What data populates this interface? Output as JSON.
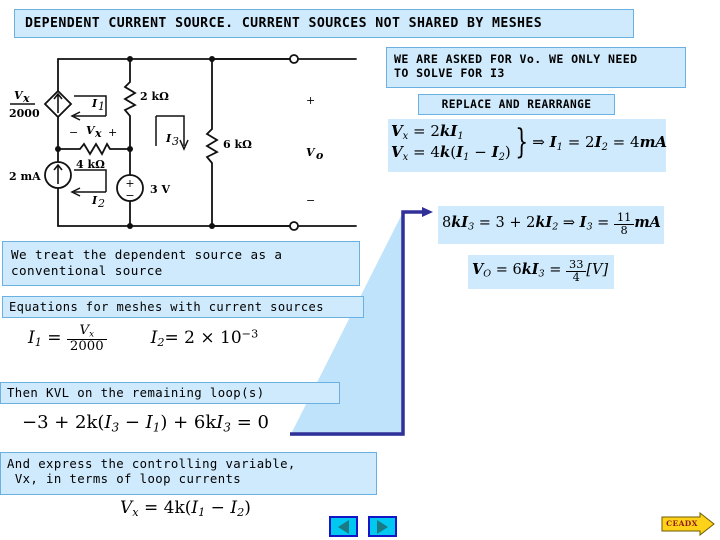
{
  "slide": {
    "title": "DEPENDENT CURRENT SOURCE. CURRENT SOURCES NOT SHARED BY MESHES",
    "background_color": "#ffffff",
    "callout_fill": "#cfeafc",
    "callout_border": "#6ab0e0",
    "arrow_fill": "#bfe3fa",
    "arrow_border": "#303098"
  },
  "callouts": {
    "asked": "WE ARE ASKED FOR Vo. WE ONLY NEED\nTO SOLVE FOR I3",
    "replace": "REPLACE AND REARRANGE",
    "treat": "We treat the dependent source as a\nconventional source",
    "meshes": "Equations for meshes with current sources",
    "kvl": "Then KVL on the remaining loop(s)",
    "express": "And express the controlling variable,\n Vx, in terms of loop currents"
  },
  "equations": {
    "i1_def": {
      "lhs": "I",
      "lhs_sub": "1",
      "eq": "=",
      "numerator": "V",
      "numerator_sub": "x",
      "denominator": "2000"
    },
    "i2_def": {
      "lhs": "I",
      "lhs_sub": "2",
      "eq": "=",
      "rhs": "2 × 10",
      "exponent": "−3"
    },
    "kvl_loop": {
      "text": "−3 + 2k(I₃ − I₁) + 6kI₃ = 0",
      "parts": [
        "−3 + 2k(",
        "I",
        "3",
        " − ",
        "I",
        "1",
        ") + 6k",
        "I",
        "3",
        " = 0"
      ]
    },
    "vx_control": {
      "text": "Vx = 4k(I₁ − I₂)",
      "lhs": "V",
      "lhs_sub": "x",
      "rhs": "4k(I₁ − I₂)"
    },
    "vx_pair": {
      "line1": "Vx = 2kI₁",
      "line2": "Vx = 4k(I₁ − I₂)",
      "result": "⇒ I₁ = 2I₂ = 4mA"
    },
    "i3_solve": {
      "lhs": "8kI₃ = 3 + 2kI₂",
      "implies": "⇒",
      "rhs_lhs": "I₃ =",
      "fraction_num": "11",
      "fraction_den": "8",
      "units": "mA"
    },
    "vo_solve": {
      "lhs": "VO = 6kI₃ =",
      "fraction_num": "33",
      "fraction_den": "4",
      "units": "[V]"
    }
  },
  "circuit": {
    "labels": {
      "dependent_source_num": "Vx",
      "dependent_source_den": "2000",
      "mesh1": "I1",
      "mesh2": "I2",
      "mesh3": "I3",
      "r_2k": "2 kΩ",
      "r_4k": "4 kΩ",
      "r_6k": "6 kΩ",
      "vx": "Vx",
      "vx_minus": "−",
      "vx_plus": "+",
      "src_2ma": "2 mA",
      "src_3v": "3 V",
      "src_3v_plus": "+",
      "src_3v_minus": "−",
      "vo": "Vo",
      "vo_plus": "+",
      "vo_minus": "−"
    }
  },
  "nav": {
    "prev_label": "previous-slide",
    "next_label": "next-slide",
    "button_fill": "#00c8f0",
    "button_border": "#1515c8"
  },
  "logo": {
    "text": "CEADX",
    "fill": "#ffd21a",
    "border": "#6b5b00"
  }
}
